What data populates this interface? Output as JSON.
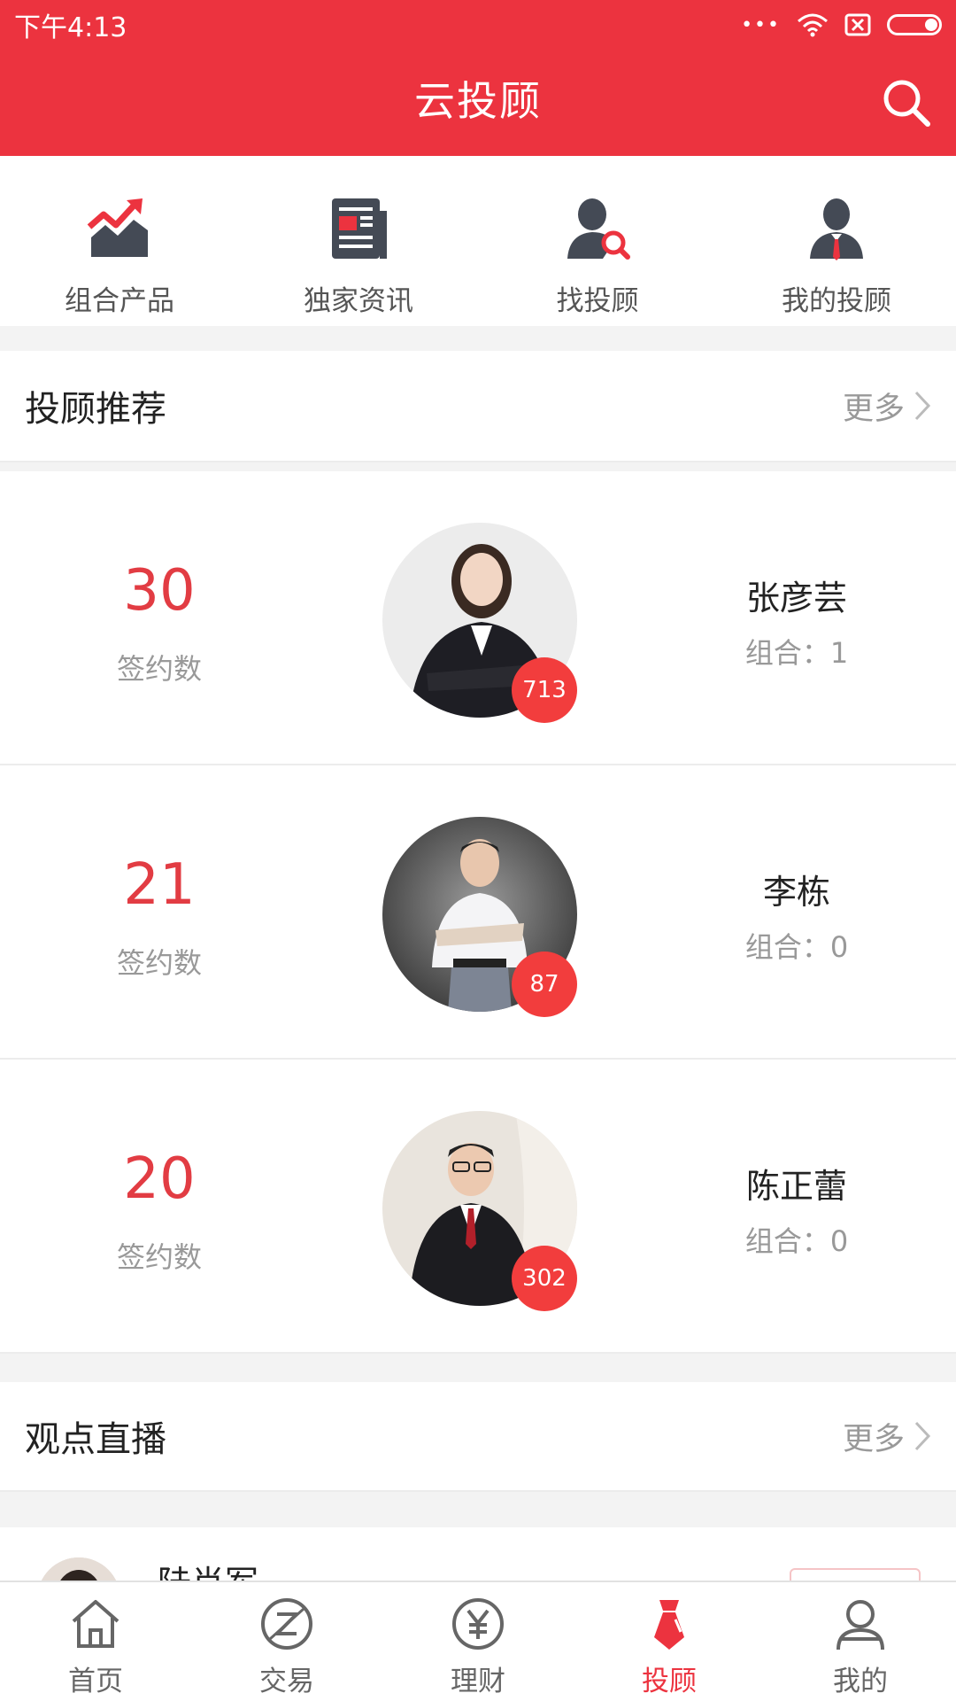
{
  "status_bar": {
    "time": "下午4:13",
    "dots": "•••"
  },
  "header": {
    "title": "云投顾"
  },
  "quick_nav": [
    {
      "label": "组合产品",
      "icon": "chart-trend-icon"
    },
    {
      "label": "独家资讯",
      "icon": "news-icon"
    },
    {
      "label": "找投顾",
      "icon": "find-advisor-icon"
    },
    {
      "label": "我的投顾",
      "icon": "my-advisor-icon"
    }
  ],
  "recommend": {
    "title": "投顾推荐",
    "more": "更多",
    "advisors": [
      {
        "count": "30",
        "count_label": "签约数",
        "badge": "713",
        "name": "张彦芸",
        "combo": "组合：1"
      },
      {
        "count": "21",
        "count_label": "签约数",
        "badge": "87",
        "name": "李栋",
        "combo": "组合：0"
      },
      {
        "count": "20",
        "count_label": "签约数",
        "badge": "302",
        "name": "陈正蕾",
        "combo": "组合：0"
      }
    ]
  },
  "live": {
    "title": "观点直播",
    "more": "更多",
    "first_name": "陆肖军"
  },
  "tab_bar": [
    {
      "label": "首页",
      "icon": "home-icon"
    },
    {
      "label": "交易",
      "icon": "trade-icon"
    },
    {
      "label": "理财",
      "icon": "yuan-icon"
    },
    {
      "label": "投顾",
      "icon": "advisor-tie-icon",
      "active": true
    },
    {
      "label": "我的",
      "icon": "user-icon"
    }
  ],
  "colors": {
    "brand": "#ec333f",
    "count": "#e23c43",
    "badge": "#f23d3d"
  }
}
